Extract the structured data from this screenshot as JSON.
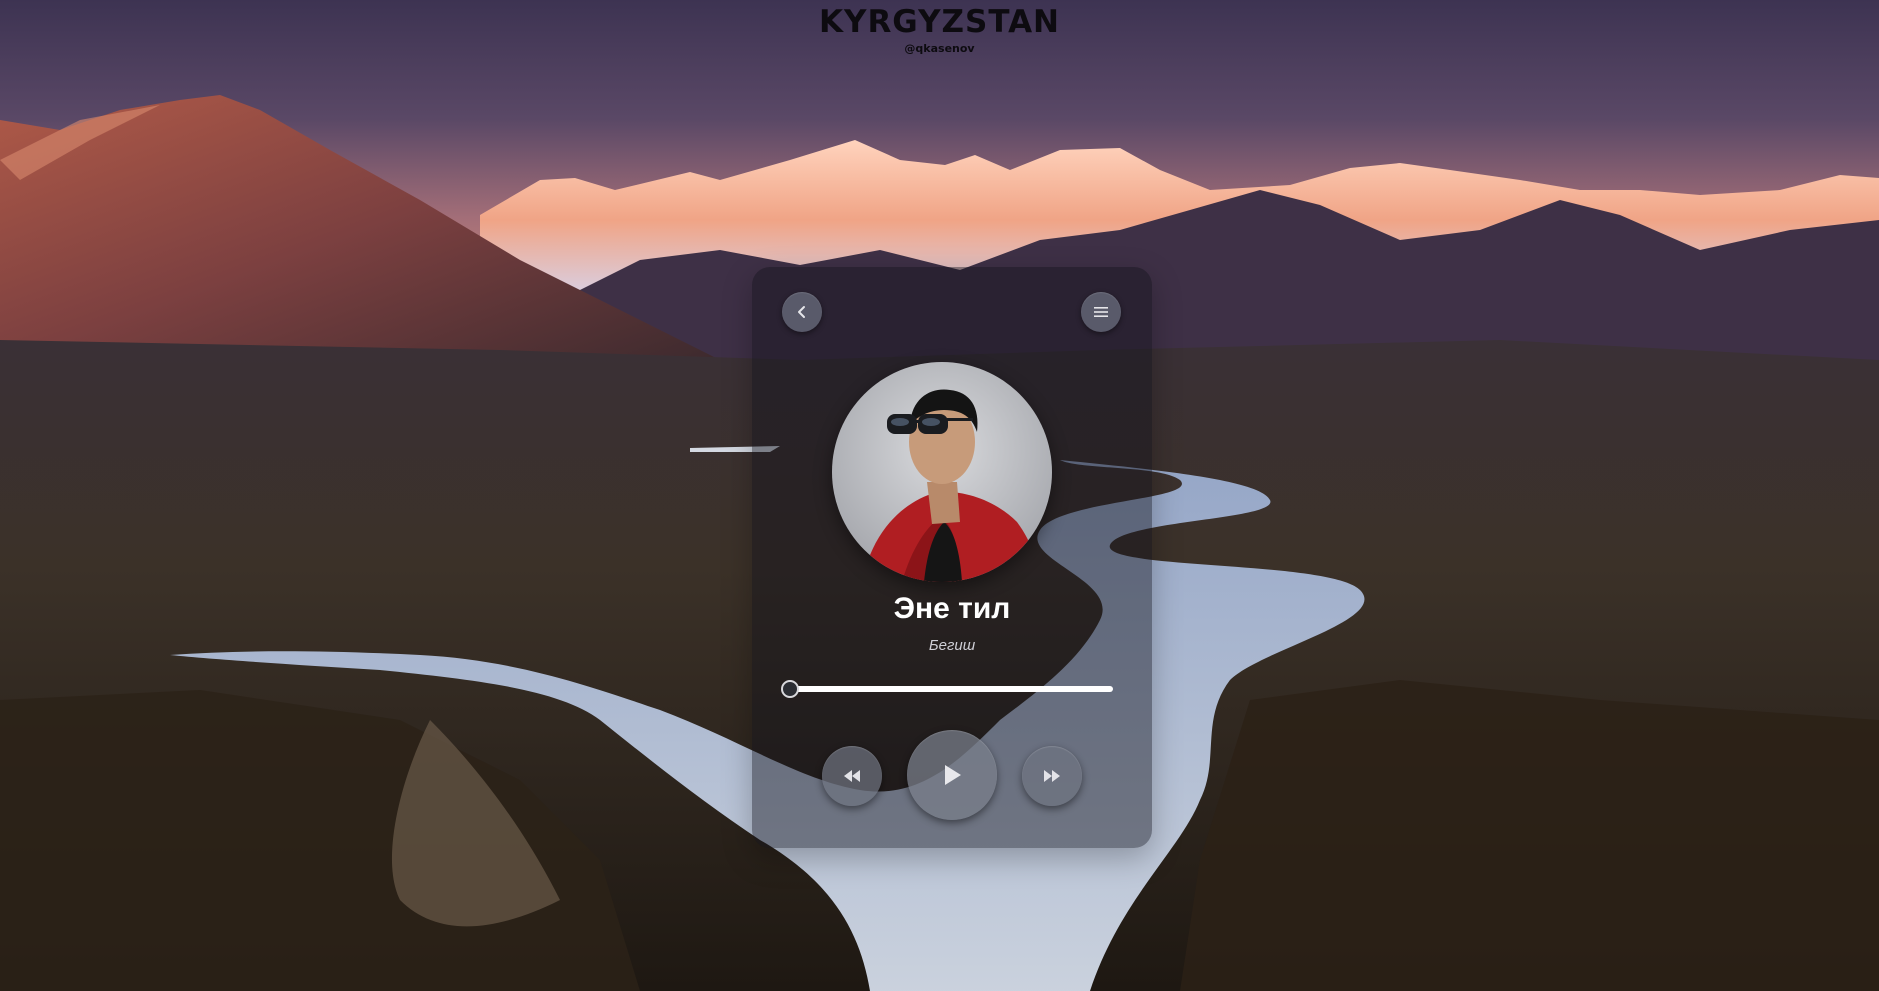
{
  "header": {
    "title": "KYRGYZSTAN",
    "handle": "@qkasenov"
  },
  "player": {
    "song_title": "Эне тил",
    "artist": "Бегиш",
    "progress_fraction": 0.0,
    "icons": {
      "back": "chevron-left-icon",
      "menu": "hamburger-menu-icon",
      "prev": "rewind-icon",
      "play": "play-icon",
      "next": "fast-forward-icon"
    }
  },
  "colors": {
    "accent_text": "#ffffff",
    "card_background": "rgba(18,18,26,0.45)",
    "button": "#6e7380",
    "title_text": "#0d0b10"
  }
}
